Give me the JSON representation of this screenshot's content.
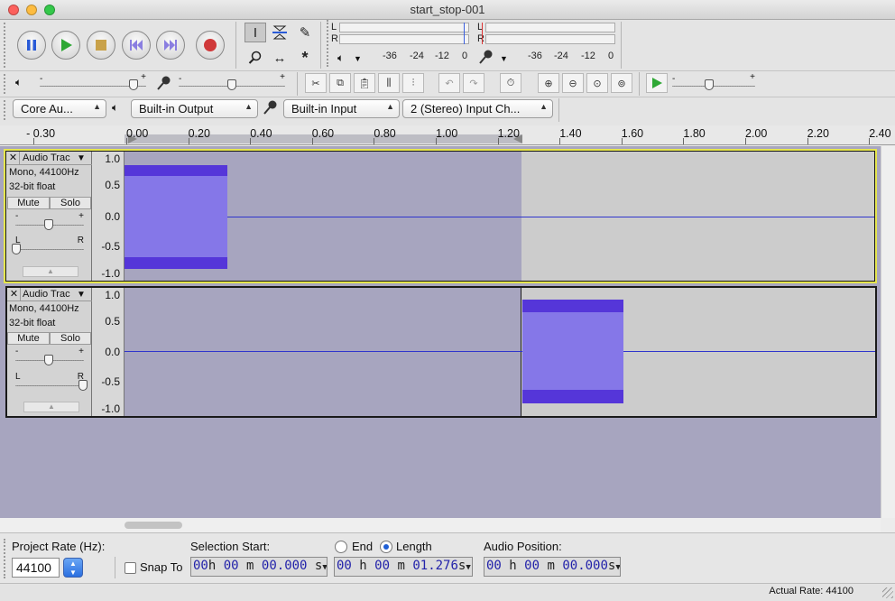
{
  "window": {
    "title": "start_stop-001"
  },
  "transport": {
    "pause_icon": "pause-icon",
    "play_icon": "play-icon",
    "stop_icon": "stop-icon",
    "skip_start_icon": "skip-to-start-icon",
    "skip_end_icon": "skip-to-end-icon",
    "record_icon": "record-icon"
  },
  "meters": {
    "playback": {
      "channel_l": "L",
      "channel_r": "R",
      "scale": [
        "-36",
        "-24",
        "-12",
        "0"
      ]
    },
    "record": {
      "channel_l": "L",
      "channel_r": "R",
      "scale": [
        "-36",
        "-24",
        "-12",
        "0"
      ]
    }
  },
  "mixer": {
    "playback_volume": 0.88,
    "record_volume": 0.5,
    "play_at_speed": 0.45
  },
  "devices": {
    "host": "Core Au...",
    "output": "Built-in Output",
    "input": "Built-in Input",
    "channels": "2 (Stereo) Input Ch..."
  },
  "ruler": {
    "ticks": [
      "- 0.30",
      "0.00",
      "0.20",
      "0.40",
      "0.60",
      "0.80",
      "1.00",
      "1.20",
      "1.40",
      "1.60",
      "1.80",
      "2.00",
      "2.20",
      "2.40"
    ]
  },
  "tracks": [
    {
      "name": "Audio Trac",
      "format": "Mono, 44100Hz",
      "bits": "32-bit float",
      "mute": "Mute",
      "solo": "Solo",
      "gain_minus": "-",
      "gain_plus": "+",
      "pan_l": "L",
      "pan_r": "R",
      "scale": [
        "1.0",
        "0.5",
        "0.0",
        "-0.5",
        "-1.0"
      ]
    },
    {
      "name": "Audio Trac",
      "format": "Mono, 44100Hz",
      "bits": "32-bit float",
      "mute": "Mute",
      "solo": "Solo",
      "gain_minus": "-",
      "gain_plus": "+",
      "pan_l": "L",
      "pan_r": "R",
      "scale": [
        "1.0",
        "0.5",
        "0.0",
        "-0.5",
        "-1.0"
      ]
    }
  ],
  "selection_toolbar": {
    "project_rate_label": "Project Rate (Hz):",
    "project_rate_value": "44100",
    "snap_to_label": "Snap To",
    "selection_start_label": "Selection Start:",
    "end_label": "End",
    "length_label": "Length",
    "length_selected": true,
    "audio_position_label": "Audio Position:",
    "selection_start": {
      "hh": "00",
      "mm": "00",
      "ss": "00.000",
      "unit": "s"
    },
    "length": {
      "hh": "00",
      "mm": "00",
      "ss": "01.276",
      "unit": "s"
    },
    "audio_position": {
      "hh": "00",
      "mm": "00",
      "ss": "00.000",
      "unit": "s"
    },
    "h": "h",
    "m": "m"
  },
  "status": {
    "actual_rate": "Actual Rate: 44100"
  },
  "colors": {
    "waveform": "#8577e8",
    "waveform_peak": "#5536d9",
    "selection": "#a7a5bf",
    "clip_background": "#cccccc",
    "zero_line": "#2f35cc"
  }
}
